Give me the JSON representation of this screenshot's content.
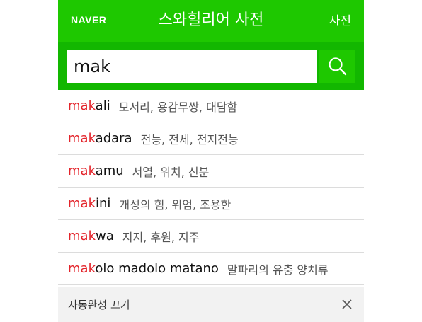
{
  "header": {
    "logo": "NAVER",
    "title": "스와힐리어 사전",
    "dict_link": "사전"
  },
  "search": {
    "value": "mak",
    "button_icon": "search-icon"
  },
  "suggestions": [
    {
      "prefix": "mak",
      "rest": "ali",
      "meaning": "모서리, 용감무쌍, 대담함"
    },
    {
      "prefix": "mak",
      "rest": "adara",
      "meaning": "전능, 전세, 전지전능"
    },
    {
      "prefix": "mak",
      "rest": "amu",
      "meaning": "서열, 위치, 신분"
    },
    {
      "prefix": "mak",
      "rest": "ini",
      "meaning": "개성의 힘, 위엄, 조용한"
    },
    {
      "prefix": "mak",
      "rest": "wa",
      "meaning": "지지, 후원, 지주"
    },
    {
      "prefix": "mak",
      "rest": "olo madolo matano",
      "meaning": "말파리의 유충 양치류"
    }
  ],
  "footer": {
    "label": "자동완성 끄기",
    "close_icon": "close-icon"
  },
  "colors": {
    "brand_green": "#1ec800",
    "search_bar_green": "#12b700",
    "match_red": "#e3242b"
  }
}
